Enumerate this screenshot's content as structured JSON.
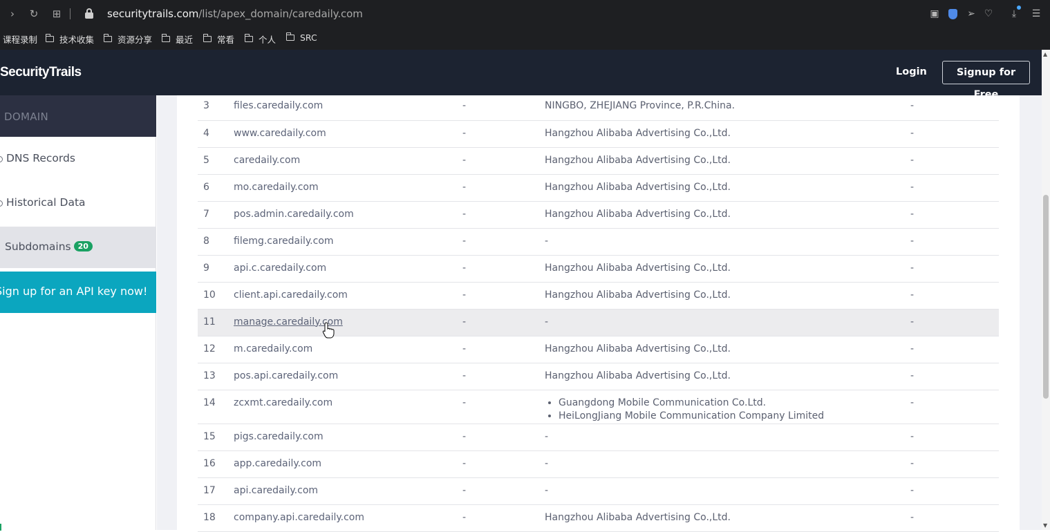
{
  "browser": {
    "url_host": "securitytrails.com",
    "url_path": "/list/apex_domain/caredaily.com",
    "bookmarks": [
      "课程录制",
      "技术收集",
      "资源分享",
      "最近",
      "常看",
      "个人",
      "SRC"
    ]
  },
  "header": {
    "logo": "SecurityTrails",
    "login": "Login",
    "signup": "Signup for Free"
  },
  "sidebar": {
    "section": "DOMAIN",
    "items": [
      {
        "label": "DNS Records"
      },
      {
        "label": "Historical Data"
      },
      {
        "label": "Subdomains",
        "badge": "20"
      }
    ],
    "cta": "Sign up for an API key now!"
  },
  "table": {
    "rows": [
      {
        "n": "3",
        "host": "files.caredaily.com",
        "c2": "-",
        "org": "NINGBO, ZHEJIANG Province, P.R.China.",
        "c4": "-"
      },
      {
        "n": "4",
        "host": "www.caredaily.com",
        "c2": "-",
        "org": "Hangzhou Alibaba Advertising Co.,Ltd.",
        "c4": "-"
      },
      {
        "n": "5",
        "host": "caredaily.com",
        "c2": "-",
        "org": "Hangzhou Alibaba Advertising Co.,Ltd.",
        "c4": "-"
      },
      {
        "n": "6",
        "host": "mo.caredaily.com",
        "c2": "-",
        "org": "Hangzhou Alibaba Advertising Co.,Ltd.",
        "c4": "-"
      },
      {
        "n": "7",
        "host": "pos.admin.caredaily.com",
        "c2": "-",
        "org": "Hangzhou Alibaba Advertising Co.,Ltd.",
        "c4": "-"
      },
      {
        "n": "8",
        "host": "filemg.caredaily.com",
        "c2": "-",
        "org": "-",
        "c4": "-"
      },
      {
        "n": "9",
        "host": "api.c.caredaily.com",
        "c2": "-",
        "org": "Hangzhou Alibaba Advertising Co.,Ltd.",
        "c4": "-"
      },
      {
        "n": "10",
        "host": "client.api.caredaily.com",
        "c2": "-",
        "org": "Hangzhou Alibaba Advertising Co.,Ltd.",
        "c4": "-"
      },
      {
        "n": "11",
        "host": "manage.caredaily.com",
        "c2": "-",
        "org": "-",
        "c4": "-"
      },
      {
        "n": "12",
        "host": "m.caredaily.com",
        "c2": "-",
        "org": "Hangzhou Alibaba Advertising Co.,Ltd.",
        "c4": "-"
      },
      {
        "n": "13",
        "host": "pos.api.caredaily.com",
        "c2": "-",
        "org": "Hangzhou Alibaba Advertising Co.,Ltd.",
        "c4": "-"
      },
      {
        "n": "14",
        "host": "zcxmt.caredaily.com",
        "c2": "-",
        "org_list": [
          "Guangdong Mobile Communication Co.Ltd.",
          "HeiLongJiang Mobile Communication Company Limited"
        ],
        "c4": "-"
      },
      {
        "n": "15",
        "host": "pigs.caredaily.com",
        "c2": "-",
        "org": "-",
        "c4": "-"
      },
      {
        "n": "16",
        "host": "app.caredaily.com",
        "c2": "-",
        "org": "-",
        "c4": "-"
      },
      {
        "n": "17",
        "host": "api.caredaily.com",
        "c2": "-",
        "org": "-",
        "c4": "-"
      },
      {
        "n": "18",
        "host": "company.api.caredaily.com",
        "c2": "-",
        "org": "Hangzhou Alibaba Advertising Co.,Ltd.",
        "c4": "-"
      }
    ]
  }
}
